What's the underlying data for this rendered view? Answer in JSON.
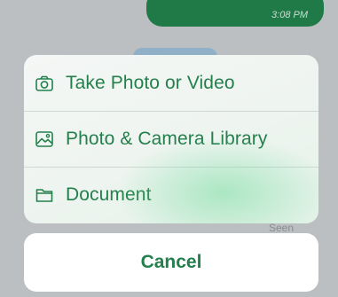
{
  "chat": {
    "message_time": "3:08 PM",
    "seen_label": "Seen"
  },
  "action_sheet": {
    "accent_color": "#23804c",
    "actions": [
      {
        "label": "Take Photo or Video",
        "icon": "camera-icon"
      },
      {
        "label": "Photo & Camera Library",
        "icon": "photo-library-icon"
      },
      {
        "label": "Document",
        "icon": "folder-icon"
      }
    ],
    "cancel_label": "Cancel"
  }
}
